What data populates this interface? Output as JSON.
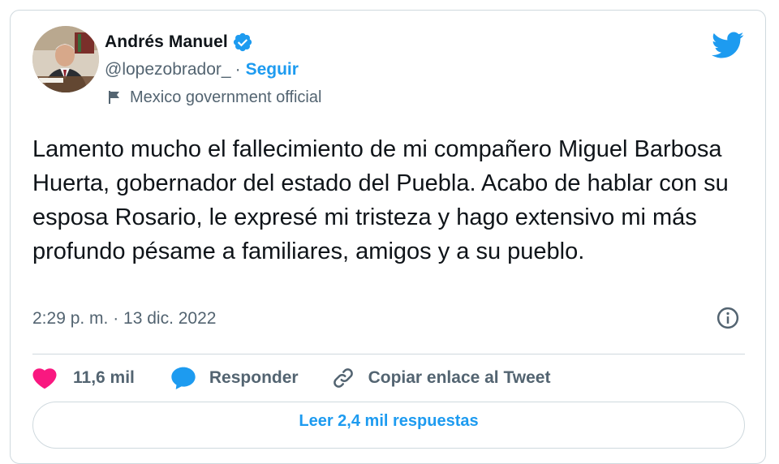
{
  "author": {
    "name": "Andrés Manuel",
    "handle": "@lopezobrador_",
    "separator": "·",
    "follow_label": "Seguir",
    "label": "Mexico government official",
    "verified_icon": "verified-badge-icon",
    "label_icon": "flag-icon"
  },
  "tweet": {
    "text": "Lamento mucho el fallecimiento de mi compañero Miguel Barbosa Huerta, gobernador del estado del Puebla. Acabo de hablar con su esposa Rosario, le expresé mi tristeza y hago extensivo mi más profundo pésame a familiares, amigos y a su pueblo.",
    "timestamp": "2:29 p. m. · 13 dic. 2022"
  },
  "actions": {
    "like_count": "11,6 mil",
    "reply_label": "Responder",
    "copy_label": "Copiar enlace al Tweet"
  },
  "replies_button": {
    "label": "Leer 2,4 mil respuestas"
  },
  "colors": {
    "accent": "#1d9bf0",
    "like": "#f91880",
    "text": "#0f1419",
    "muted": "#536471",
    "border": "#cfd9de"
  }
}
